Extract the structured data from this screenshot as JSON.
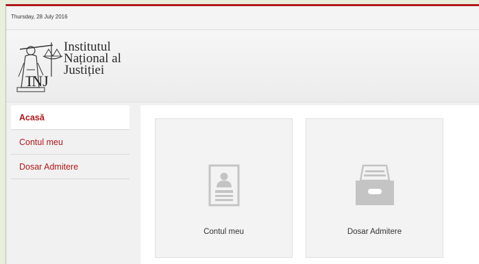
{
  "topbar": {
    "date": "Thursday, 28 July 2016"
  },
  "header": {
    "logo_lines": [
      "Institutul",
      "Național al",
      "Justiției"
    ],
    "logo_letters": "INJ"
  },
  "sidebar": {
    "items": [
      {
        "label": "Acasă",
        "active": true
      },
      {
        "label": "Contul meu",
        "active": false
      },
      {
        "label": "Dosar Admitere",
        "active": false
      }
    ]
  },
  "cards": [
    {
      "label": "Contul meu",
      "icon": "profile-document-icon"
    },
    {
      "label": "Dosar Admitere",
      "icon": "archive-box-icon"
    }
  ],
  "colors": {
    "brand_red": "#b0161b",
    "icon_gray": "#c4c4c4"
  }
}
